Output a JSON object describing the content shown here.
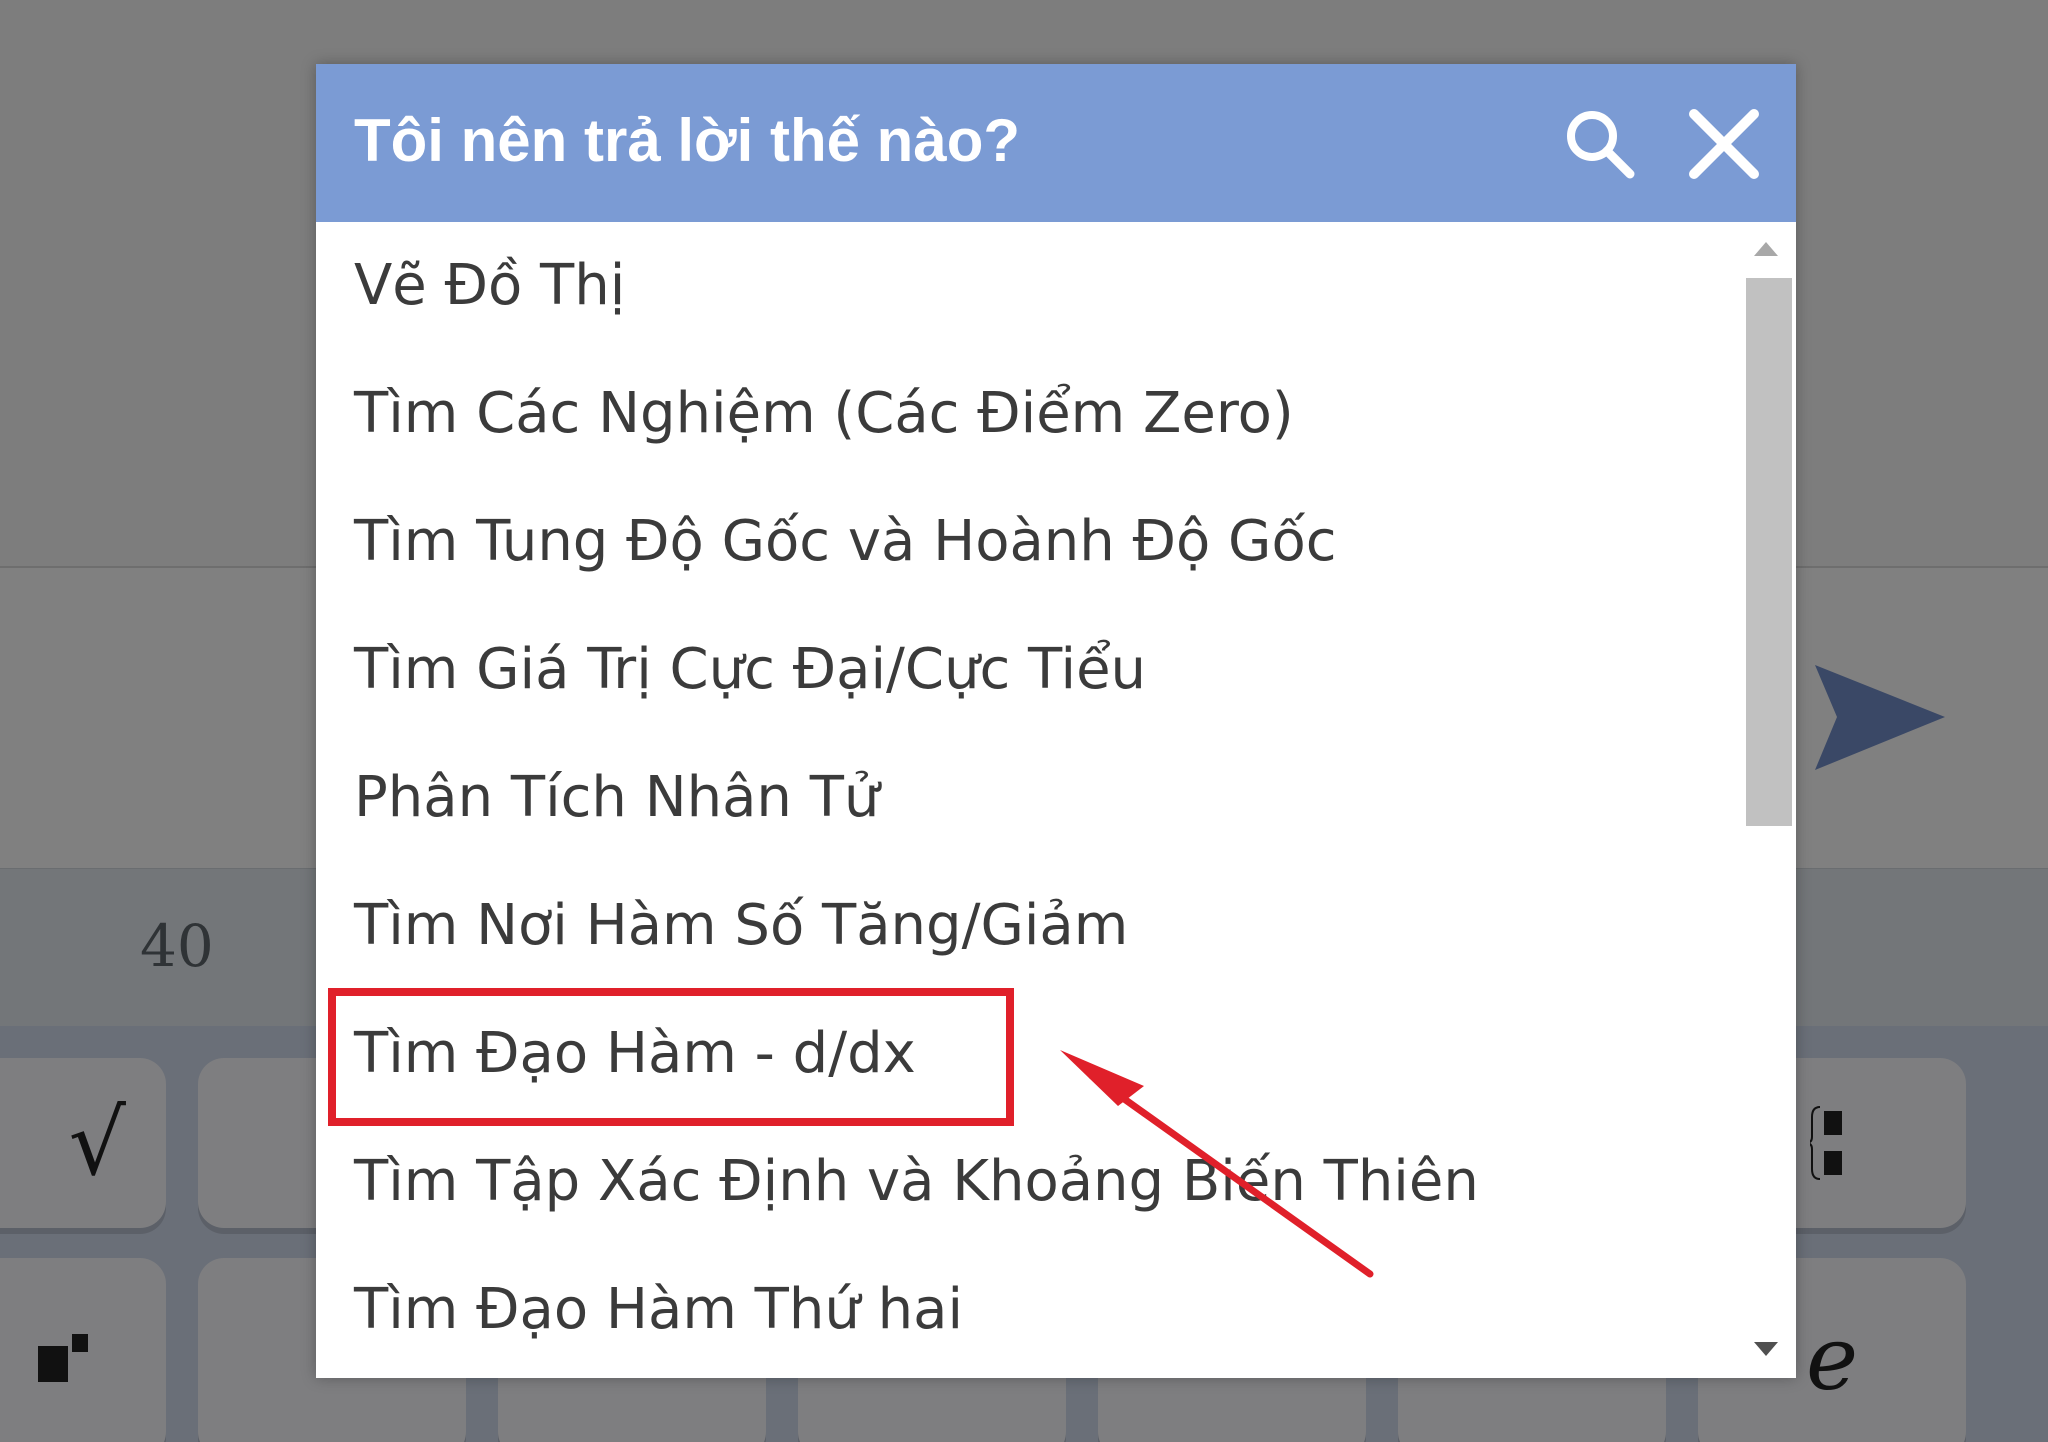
{
  "dialog": {
    "title": "Tôi nên trả lời thế nào?",
    "search_icon": "search-icon",
    "close_icon": "close-icon",
    "options": [
      {
        "label": "Vẽ Đồ Thị"
      },
      {
        "label": "Tìm Các Nghiệm (Các Điểm Zero)"
      },
      {
        "label": "Tìm Tung Độ Gốc và Hoành Độ Gốc"
      },
      {
        "label": "Tìm Giá Trị Cực Đại/Cực Tiểu"
      },
      {
        "label": "Phân Tích Nhân Tử"
      },
      {
        "label": "Tìm Nơi Hàm Số Tăng/Giảm"
      },
      {
        "label": "Tìm Đạo Hàm - d/dx",
        "highlighted": true
      },
      {
        "label": "Tìm Tập Xác Định và Khoảng Biến Thiên"
      },
      {
        "label": "Tìm Đạo Hàm Thứ hai"
      }
    ],
    "accent_color": "#7b9bd4",
    "highlight_color": "#e0202a"
  },
  "background": {
    "keyboard_number": "40",
    "sqrt_key": "√",
    "e_key": "e",
    "send_icon": "send-arrow-icon"
  }
}
